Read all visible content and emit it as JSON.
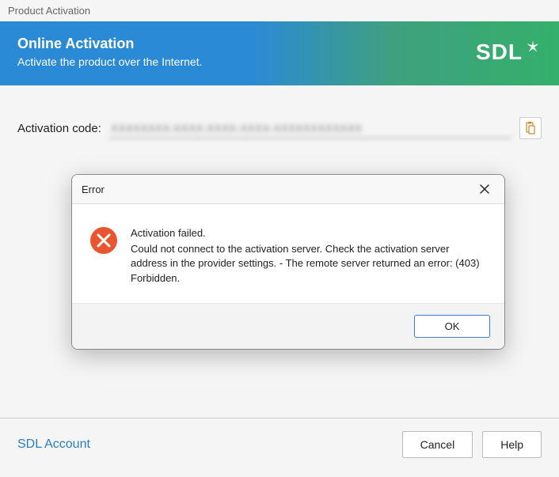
{
  "window": {
    "title": "Product Activation"
  },
  "banner": {
    "title": "Online Activation",
    "subtitle": "Activate the product over the Internet.",
    "logo_text": "SDL"
  },
  "form": {
    "activation_label": "Activation code:",
    "activation_value": "XXXXXXXX-XXXX-XXXX-XXXX-XXXXXXXXXXXX",
    "paste_icon": "clipboard-icon"
  },
  "modal": {
    "title": "Error",
    "headline": "Activation failed.",
    "message": "Could not connect to the activation server. Check the activation server address in the provider settings. - The remote server returned an error: (403) Forbidden.",
    "ok_label": "OK"
  },
  "footer": {
    "account_link": "SDL Account",
    "cancel_label": "Cancel",
    "help_label": "Help"
  }
}
